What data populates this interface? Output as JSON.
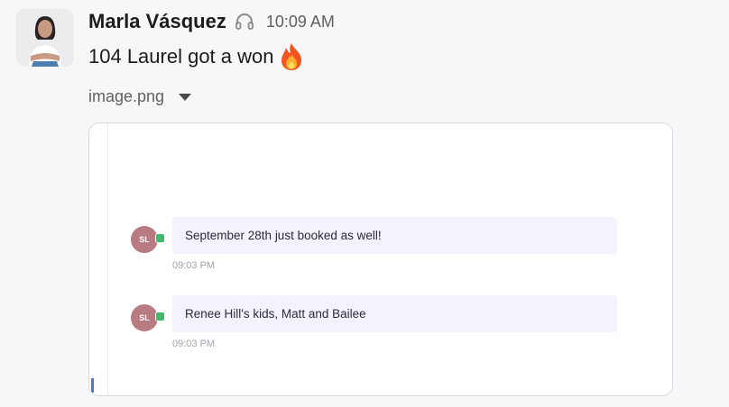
{
  "post": {
    "sender": "Marla Vásquez",
    "status_icon": "headphones-icon",
    "time": "10:09 AM",
    "message_text": "104 Laurel got a won",
    "emoji": "fire-emoji"
  },
  "attachment": {
    "file_name": "image.png",
    "preview": {
      "messages": [
        {
          "initials": "SL",
          "text": "September 28th just booked as well!",
          "time": "09:03 PM"
        },
        {
          "initials": "SL",
          "text": "Renee Hill's kids, Matt and Bailee",
          "time": "09:03 PM"
        }
      ]
    }
  },
  "colors": {
    "background": "#f7f6f8",
    "avatar_badge": "#44b86a",
    "preview_avatar": "#b87b82",
    "bubble": "#f3f3fb"
  }
}
